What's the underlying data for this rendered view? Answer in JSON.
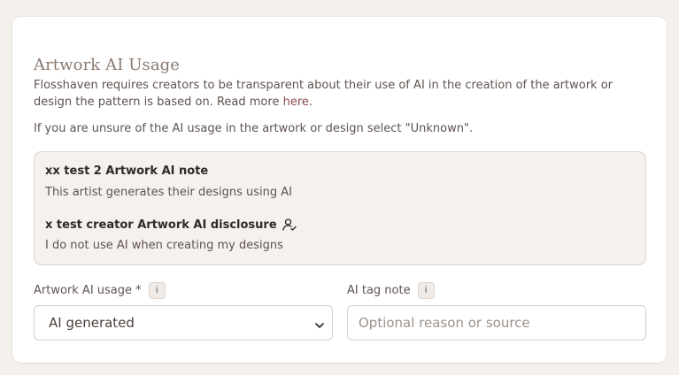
{
  "section": {
    "title": "Artwork AI Usage",
    "description_lead": "Flosshaven requires creators to be transparent about their use of AI in the creation of the artwork or design the pattern is based on. Read more ",
    "read_more_link": "here",
    "description_tail": ".",
    "unsure_note": "If you are unsure of the AI usage in the artwork or design select \"Unknown\"."
  },
  "notes": [
    {
      "title": "xx test 2 Artwork AI note",
      "text": "This artist generates their designs using AI"
    },
    {
      "title": "x test creator Artwork AI disclosure",
      "icon": "person-check-icon",
      "text": "I do not use AI when creating my designs"
    }
  ],
  "fields": {
    "usage": {
      "label": "Artwork AI usage *",
      "info": "i",
      "value": "AI generated"
    },
    "tag_note": {
      "label": "AI tag note",
      "info": "i",
      "placeholder": "Optional reason or source",
      "value": ""
    }
  },
  "colors": {
    "background": "#f4f0ec",
    "card": "#ffffff",
    "title": "#8a7a6f",
    "link": "#8c4d4d",
    "notes_bg": "#f5f1ee",
    "border": "#ddd5cf"
  }
}
